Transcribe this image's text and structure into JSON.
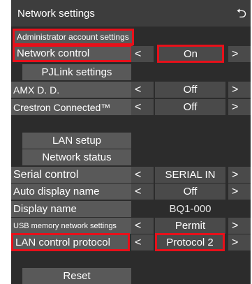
{
  "window": {
    "title": "Network settings",
    "back_icon": "return-arrow-icon"
  },
  "rows": {
    "admin": "Administrator account settings",
    "network_control": {
      "label": "Network control",
      "value": "On"
    },
    "pjlink": "PJLink settings",
    "amx": {
      "label": "AMX D. D.",
      "value": "Off"
    },
    "crestron": {
      "label": "Crestron Connected™",
      "value": "Off"
    },
    "lan_setup": "LAN setup",
    "network_status": "Network status",
    "serial_control": {
      "label": "Serial control",
      "value": "SERIAL IN"
    },
    "auto_display_name": {
      "label": "Auto display name",
      "value": "Off"
    },
    "display_name": {
      "label": "Display name",
      "value": "BQ1-000"
    },
    "usb_memory": {
      "label": "USB memory network settings",
      "value": "Permit"
    },
    "lan_protocol": {
      "label": "LAN control protocol",
      "value": "Protocol 2"
    },
    "reset": "Reset"
  },
  "arrows": {
    "left": "<",
    "right": ">"
  },
  "colors": {
    "highlight": "#e8101a",
    "panel": "#2c2c2c",
    "row": "#595959",
    "value_bg": "#4a4a4a"
  }
}
